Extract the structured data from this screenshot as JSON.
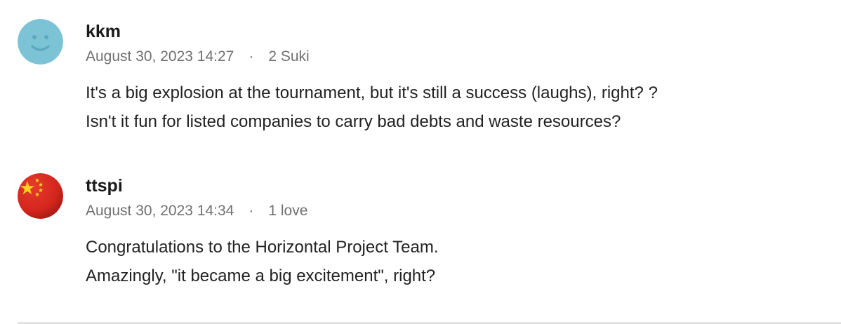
{
  "comments": [
    {
      "username": "kkm",
      "timestamp": "August 30, 2023 14:27",
      "separator": "·",
      "reactions": "2 Suki",
      "avatar": {
        "icon": "smiley-face-icon",
        "color": "#7cc3d6"
      },
      "lines": [
        "It's a big explosion at the tournament, but it's still a success (laughs), right? ?",
        "Isn't it fun for listed companies to carry bad debts and waste resources?"
      ]
    },
    {
      "username": "ttspi",
      "timestamp": "August 30, 2023 14:34",
      "separator": "·",
      "reactions": "1 love",
      "avatar": {
        "icon": "china-flag-icon",
        "color": "#d4261d"
      },
      "lines": [
        "Congratulations to the Horizontal Project Team.",
        "Amazingly, \"it became a big excitement\", right?"
      ]
    }
  ],
  "colors": {
    "text": "#222222",
    "meta": "#707070",
    "divider": "#e3e3e3"
  }
}
